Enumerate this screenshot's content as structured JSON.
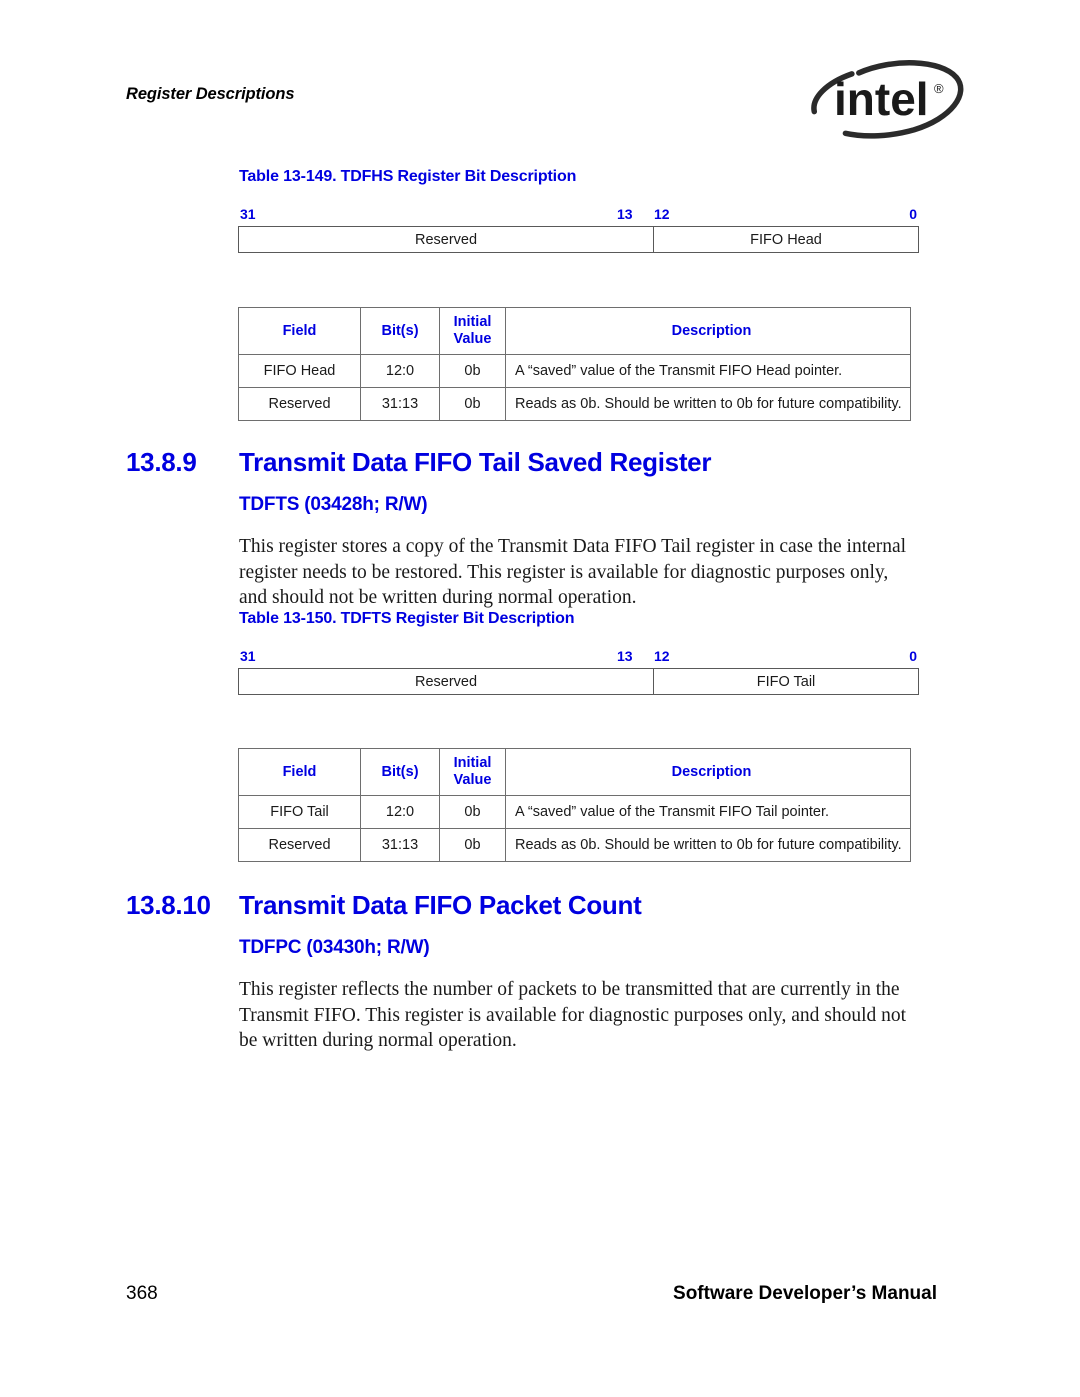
{
  "header": {
    "running_title": "Register Descriptions",
    "logo_wordmark": "intel",
    "logo_trademark": "®"
  },
  "tables": [
    {
      "caption": "Table 13-149. TDFHS Register Bit Description",
      "bit_diagram": {
        "left_bit": "31",
        "split_high_bit": "13",
        "split_low_bit": "12",
        "right_bit": "0",
        "left_field": "Reserved",
        "right_field": "FIFO Head"
      },
      "columns": [
        "Field",
        "Bit(s)",
        "Initial Value",
        "Description"
      ],
      "column_initial_line1": "Initial",
      "column_initial_line2": "Value",
      "rows": [
        {
          "field": "FIFO Head",
          "bits": "12:0",
          "initial": "0b",
          "description": "A “saved” value of the Transmit FIFO Head pointer."
        },
        {
          "field": "Reserved",
          "bits": "31:13",
          "initial": "0b",
          "description": "Reads as 0b. Should be written to 0b for future compatibility."
        }
      ]
    },
    {
      "caption": "Table 13-150. TDFTS Register Bit Description",
      "bit_diagram": {
        "left_bit": "31",
        "split_high_bit": "13",
        "split_low_bit": "12",
        "right_bit": "0",
        "left_field": "Reserved",
        "right_field": "FIFO Tail"
      },
      "columns": [
        "Field",
        "Bit(s)",
        "Initial Value",
        "Description"
      ],
      "column_initial_line1": "Initial",
      "column_initial_line2": "Value",
      "rows": [
        {
          "field": "FIFO Tail",
          "bits": "12:0",
          "initial": "0b",
          "description": "A “saved” value of the Transmit FIFO Tail pointer."
        },
        {
          "field": "Reserved",
          "bits": "31:13",
          "initial": "0b",
          "description": "Reads as 0b. Should be written to 0b for future compatibility."
        }
      ]
    }
  ],
  "sections": [
    {
      "number": "13.8.9",
      "title": "Transmit Data FIFO Tail Saved Register",
      "register": "TDFTS (03428h; R/W)",
      "body": "This register stores a copy of the Transmit Data FIFO Tail register in case the internal register needs to be restored. This register is available for diagnostic purposes only, and should not be written during normal operation."
    },
    {
      "number": "13.8.10",
      "title": "Transmit Data FIFO Packet Count",
      "register": "TDFPC (03430h; R/W)",
      "body": "This register reflects the number of packets to be transmitted that are currently in the Transmit FIFO. This register is available for diagnostic purposes only, and should not be written during normal operation."
    }
  ],
  "footer": {
    "page_number": "368",
    "manual_title": "Software Developer’s Manual"
  },
  "colors": {
    "accent_blue": "#0000E0",
    "text_black": "#1a1a1a",
    "rule_gray": "#6e6e6e"
  }
}
